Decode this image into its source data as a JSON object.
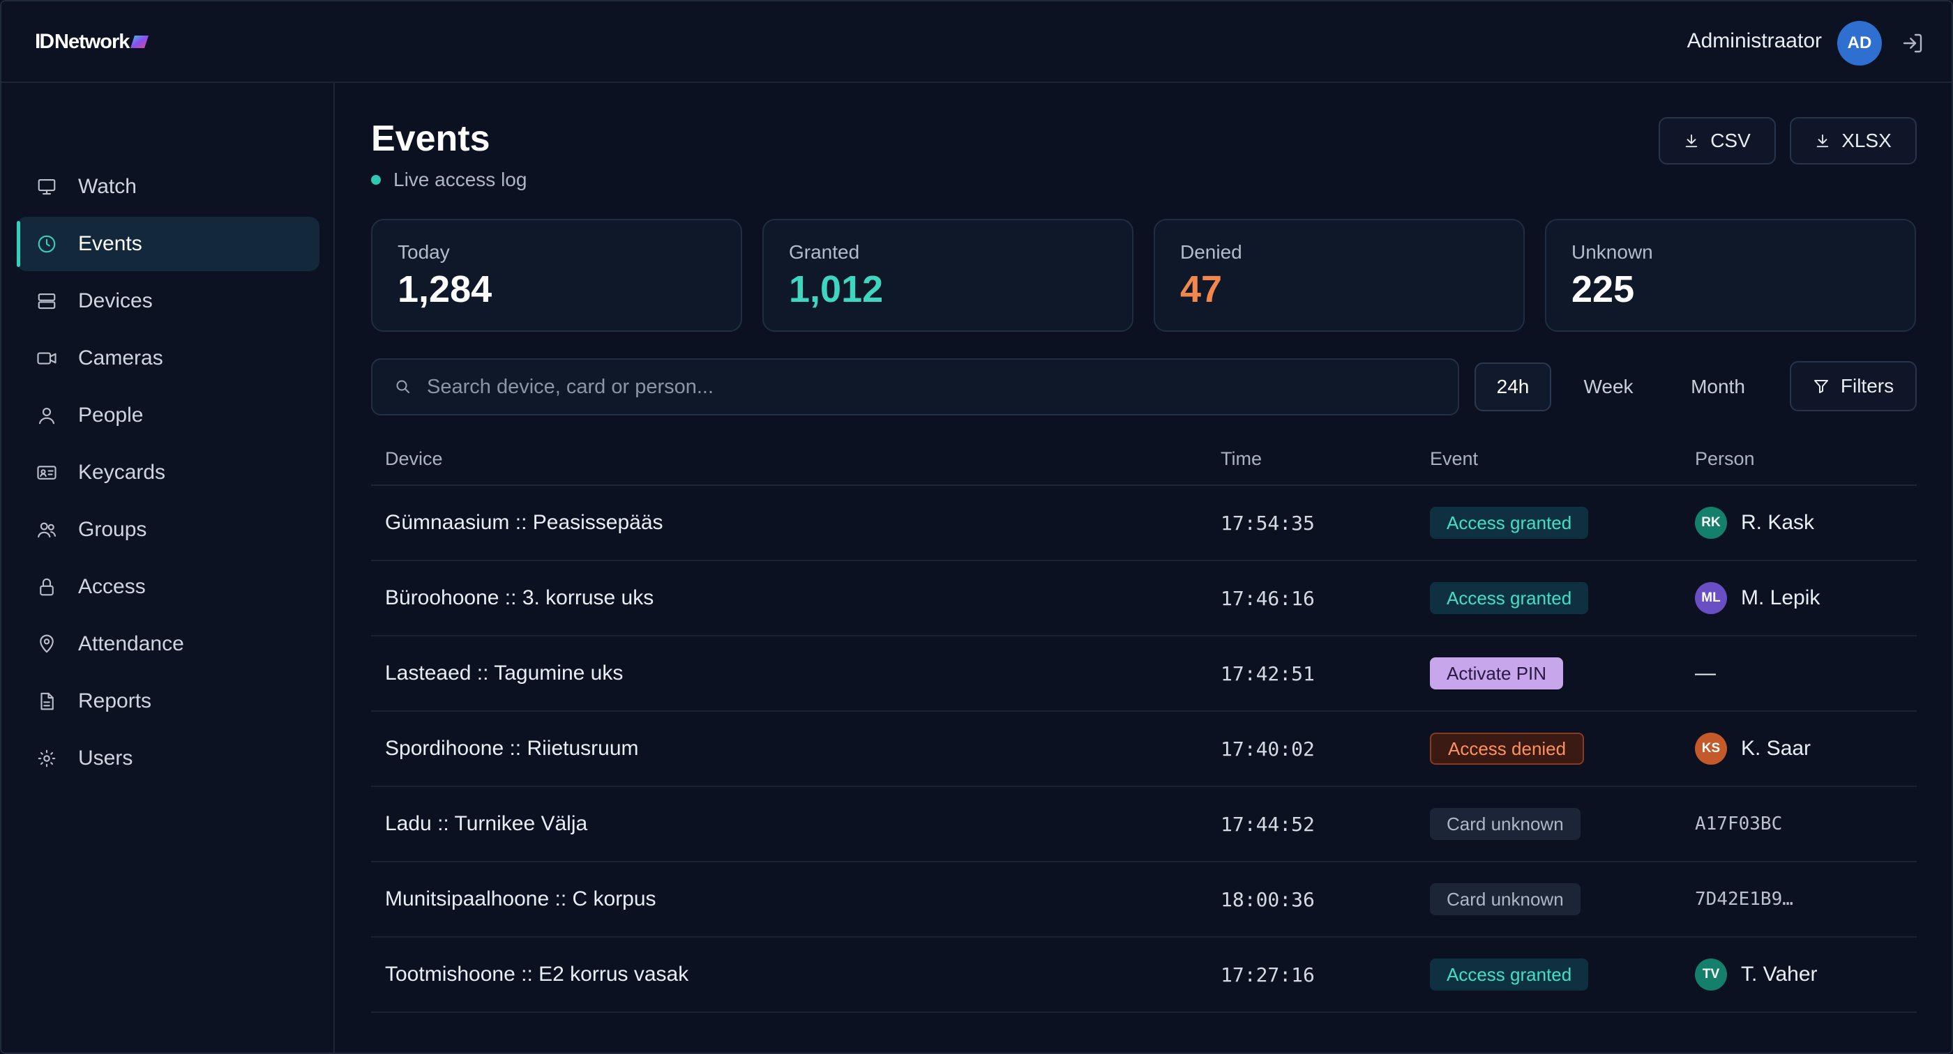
{
  "brand": {
    "logo_id": "ID",
    "logo_text": "Network"
  },
  "header": {
    "user_name": "Administraator",
    "avatar_initials": "AD"
  },
  "sidebar": {
    "items": [
      {
        "label": "Watch",
        "icon": "monitor-icon",
        "active": false
      },
      {
        "label": "Events",
        "icon": "clock-icon",
        "active": true
      },
      {
        "label": "Devices",
        "icon": "server-icon",
        "active": false
      },
      {
        "label": "Cameras",
        "icon": "video-icon",
        "active": false
      },
      {
        "label": "People",
        "icon": "user-icon",
        "active": false
      },
      {
        "label": "Keycards",
        "icon": "id-card-icon",
        "active": false
      },
      {
        "label": "Groups",
        "icon": "users-icon",
        "active": false
      },
      {
        "label": "Access",
        "icon": "lock-icon",
        "active": false
      },
      {
        "label": "Attendance",
        "icon": "map-pin-icon",
        "active": false
      },
      {
        "label": "Reports",
        "icon": "file-icon",
        "active": false
      },
      {
        "label": "Users",
        "icon": "sun-gear-icon",
        "active": false
      }
    ]
  },
  "page": {
    "title": "Events",
    "subtitle": "Live access log"
  },
  "export": {
    "csv_label": "CSV",
    "xlsx_label": "XLSX"
  },
  "stats": [
    {
      "label": "Today",
      "value": "1,284",
      "color": "#ffffff"
    },
    {
      "label": "Granted",
      "value": "1,012",
      "color": "#3fd6c0"
    },
    {
      "label": "Denied",
      "value": "47",
      "color": "#f2874d"
    },
    {
      "label": "Unknown",
      "value": "225",
      "color": "#ffffff"
    }
  ],
  "search": {
    "placeholder": "Search device, card or person...",
    "value": ""
  },
  "ranges": [
    {
      "label": "24h",
      "active": true
    },
    {
      "label": "Week",
      "active": false
    },
    {
      "label": "Month",
      "active": false
    }
  ],
  "filters_label": "Filters",
  "table": {
    "headers": {
      "device": "Device",
      "time": "Time",
      "event": "Event",
      "person": "Person"
    },
    "rows": [
      {
        "device": "Gümnaasium :: Peasissepääs",
        "time": "17:54:35",
        "event": "Access granted",
        "event_type": "granted",
        "person": "R. Kask",
        "initials": "RK",
        "avatar_color": "#14806c"
      },
      {
        "device": "Büroohoone :: 3. korruse uks",
        "time": "17:46:16",
        "event": "Access granted",
        "event_type": "granted",
        "person": "M. Lepik",
        "initials": "ML",
        "avatar_color": "#6a4ec4"
      },
      {
        "device": "Lasteaed :: Tagumine uks",
        "time": "17:42:51",
        "event": "Activate PIN",
        "event_type": "pin",
        "person": "—",
        "initials": "",
        "avatar_color": ""
      },
      {
        "device": "Spordihoone :: Riietusruum",
        "time": "17:40:02",
        "event": "Access denied",
        "event_type": "denied",
        "person": "K. Saar",
        "initials": "KS",
        "avatar_color": "#c45a2a"
      },
      {
        "device": "Ladu :: Turnikee Välja",
        "time": "17:44:52",
        "event": "Card unknown",
        "event_type": "unknown",
        "person": "A17F03BC",
        "initials": "",
        "avatar_color": ""
      },
      {
        "device": "Munitsipaalhoone :: C korpus",
        "time": "18:00:36",
        "event": "Card unknown",
        "event_type": "unknown",
        "person": "7D42E1B9…",
        "initials": "",
        "avatar_color": ""
      },
      {
        "device": "Tootmishoone :: E2 korrus vasak",
        "time": "17:27:16",
        "event": "Access granted",
        "event_type": "granted",
        "person": "T. Vaher",
        "initials": "TV",
        "avatar_color": "#14806c"
      }
    ]
  }
}
